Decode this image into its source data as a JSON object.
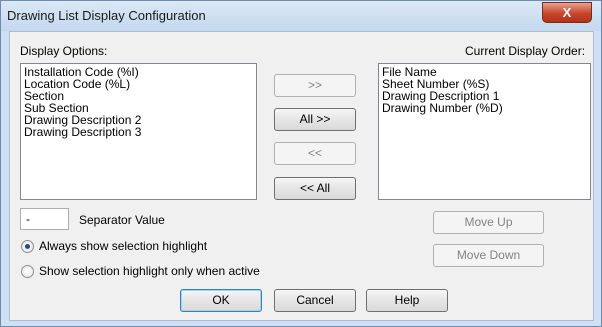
{
  "window": {
    "title": "Drawing List Display Configuration",
    "close_glyph": "X"
  },
  "display_options": {
    "label": "Display Options:",
    "items": [
      "Installation Code (%I)",
      "Location Code (%L)",
      "Section",
      "Sub Section",
      "Drawing Description 2",
      "Drawing Description 3"
    ]
  },
  "current_order": {
    "label": "Current Display Order:",
    "items": [
      "File Name",
      "Sheet Number (%S)",
      "Drawing Description 1",
      "Drawing Number (%D)"
    ]
  },
  "transfer": {
    "add": ">>",
    "add_all": "All >>",
    "remove": "<<",
    "remove_all": "<< All"
  },
  "separator": {
    "value": "-",
    "label": "Separator Value"
  },
  "radios": {
    "always": "Always show selection highlight",
    "when_active": "Show selection highlight only when active",
    "selected": "always"
  },
  "order_buttons": {
    "move_up": "Move Up",
    "move_down": "Move Down"
  },
  "footer": {
    "ok": "OK",
    "cancel": "Cancel",
    "help": "Help"
  }
}
